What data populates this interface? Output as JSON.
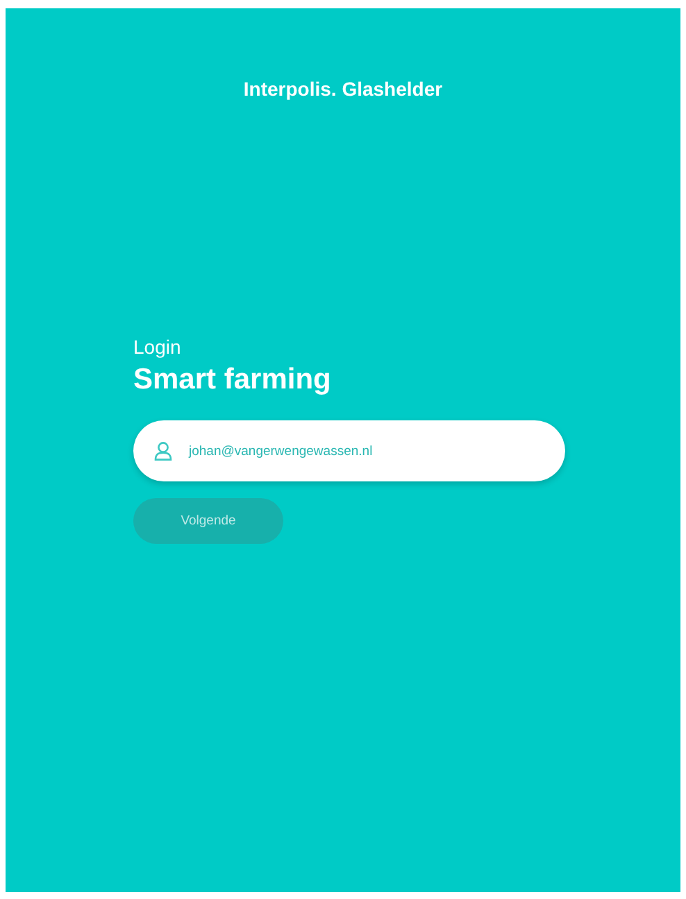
{
  "header": {
    "brand": "Interpolis. Glashelder"
  },
  "login": {
    "label": "Login",
    "title": "Smart farming",
    "email_field": {
      "value": "johan@vangerwengewassen.nl"
    },
    "next_button": {
      "label": "Volgende",
      "disabled": true
    }
  }
}
